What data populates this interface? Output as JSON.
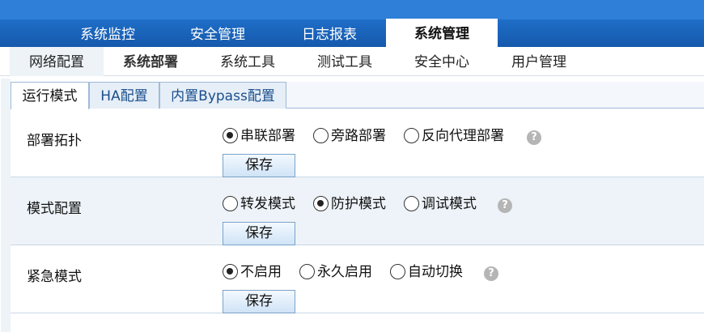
{
  "header": {
    "logo": ""
  },
  "main_nav": [
    {
      "label": "系统监控",
      "active": false
    },
    {
      "label": "安全管理",
      "active": false
    },
    {
      "label": "日志报表",
      "active": false
    },
    {
      "label": "系统管理",
      "active": true
    }
  ],
  "sub_nav": [
    {
      "label": "网络配置",
      "active": false
    },
    {
      "label": "系统部署",
      "active": true
    },
    {
      "label": "系统工具",
      "active": false
    },
    {
      "label": "测试工具",
      "active": false
    },
    {
      "label": "安全中心",
      "active": false
    },
    {
      "label": "用户管理",
      "active": false
    }
  ],
  "tabs": [
    {
      "label": "运行模式",
      "active": true
    },
    {
      "label": "HA配置",
      "active": false
    },
    {
      "label": "内置Bypass配置",
      "active": false
    }
  ],
  "rows": [
    {
      "label": "部署拓扑",
      "options": [
        {
          "label": "串联部署",
          "checked": true
        },
        {
          "label": "旁路部署",
          "checked": false
        },
        {
          "label": "反向代理部署",
          "checked": false
        }
      ],
      "save_label": "保存",
      "help_icon": "question-icon"
    },
    {
      "label": "模式配置",
      "options": [
        {
          "label": "转发模式",
          "checked": false
        },
        {
          "label": "防护模式",
          "checked": true
        },
        {
          "label": "调试模式",
          "checked": false
        }
      ],
      "save_label": "保存",
      "help_icon": "question-icon"
    },
    {
      "label": "紧急模式",
      "options": [
        {
          "label": "不启用",
          "checked": true
        },
        {
          "label": "永久启用",
          "checked": false
        },
        {
          "label": "自动切换",
          "checked": false
        }
      ],
      "save_label": "保存",
      "help_icon": "question-icon"
    }
  ],
  "colors": {
    "header_blue": "#2f7fd8",
    "nav_blue": "#1559ad",
    "row_shade": "#edf3f8",
    "tab_text": "#1a4f8c"
  }
}
